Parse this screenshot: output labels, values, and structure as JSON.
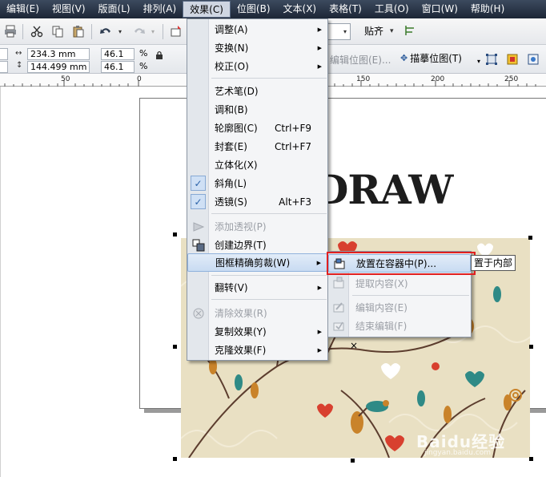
{
  "menubar": {
    "items": [
      "编辑(E)",
      "视图(V)",
      "版面(L)",
      "排列(A)",
      "效果(C)",
      "位图(B)",
      "文本(X)",
      "表格(T)",
      "工具(O)",
      "窗口(W)",
      "帮助(H)"
    ],
    "active_index": 4
  },
  "toolbar": {
    "zoom_combo_value": "",
    "snap_label": "贴齐"
  },
  "propbar": {
    "width_value": "234.3 mm",
    "height_value": "144.499 mm",
    "scale_x": "46.1",
    "scale_y": "46.1",
    "pct": "%",
    "edit_bitmap_label": "编辑位图(E)...",
    "trace_bitmap_label": "描摹位图(T)"
  },
  "ruler": {
    "labels": [
      "50",
      "0",
      "150",
      "200",
      "250"
    ]
  },
  "canvas": {
    "title_text": "DRAW"
  },
  "menu": {
    "items": [
      {
        "label": "调整(A)",
        "arrow": true
      },
      {
        "label": "变换(N)",
        "arrow": true
      },
      {
        "label": "校正(O)",
        "arrow": true
      },
      {
        "label": "艺术笔(D)"
      },
      {
        "label": "调和(B)"
      },
      {
        "label": "轮廓图(C)",
        "shortcut": "Ctrl+F9"
      },
      {
        "label": "封套(E)",
        "shortcut": "Ctrl+F7"
      },
      {
        "label": "立体化(X)"
      },
      {
        "label": "斜角(L)",
        "checked": true
      },
      {
        "label": "透镜(S)",
        "shortcut": "Alt+F3",
        "checked": true
      },
      {
        "label": "添加透视(P)",
        "disabled": true
      },
      {
        "label": "创建边界(T)"
      },
      {
        "label": "图框精确剪裁(W)",
        "arrow": true,
        "highlighted": true
      },
      {
        "label": "翻转(V)",
        "arrow": true
      },
      {
        "label": "清除效果(R)",
        "disabled": true
      },
      {
        "label": "复制效果(Y)",
        "arrow": true
      },
      {
        "label": "克隆效果(F)",
        "arrow": true
      }
    ]
  },
  "submenu": {
    "items": [
      {
        "label": "放置在容器中(P)...",
        "highlighted": true
      },
      {
        "label": "提取内容(X)",
        "disabled": true
      },
      {
        "label": "编辑内容(E)",
        "disabled": true
      },
      {
        "label": "结束编辑(F)",
        "disabled": true
      }
    ]
  },
  "tooltip": {
    "text": "置于内部"
  },
  "watermark": {
    "text": "Baidu经验",
    "url_text": "jingyan.baidu.com"
  },
  "colors": {
    "menubar_bg": "#1c2636",
    "highlight": "#c8dbf2",
    "red_box": "#e02020",
    "pattern_bg": "#e9e0c3"
  }
}
